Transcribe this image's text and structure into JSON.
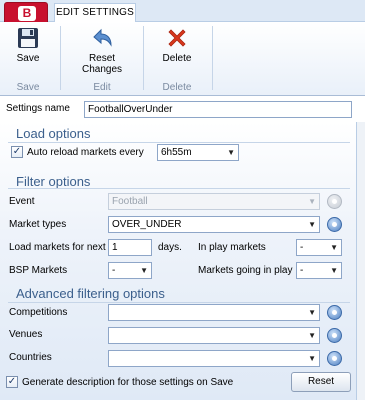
{
  "ribbon": {
    "tab_label": "EDIT SETTINGS",
    "buttons": {
      "save": "Save",
      "reset": "Reset Changes",
      "delete": "Delete"
    },
    "groups": {
      "save": "Save",
      "edit": "Edit",
      "delete": "Delete"
    }
  },
  "settings_name": {
    "label": "Settings name",
    "value": "FootballOverUnder"
  },
  "load_options": {
    "heading": "Load options",
    "auto_reload": {
      "label": "Auto reload markets every",
      "checked": true,
      "value": "6h55m"
    }
  },
  "filter_options": {
    "heading": "Filter options",
    "event": {
      "label": "Event",
      "value": "Football"
    },
    "market_types": {
      "label": "Market types",
      "value": "OVER_UNDER"
    },
    "load_markets_next": {
      "label": "Load markets for next",
      "value": "1",
      "unit": "days."
    },
    "in_play_markets": {
      "label": "In play markets",
      "value": "-"
    },
    "bsp_markets": {
      "label": "BSP Markets",
      "value": "-"
    },
    "markets_going_in_play": {
      "label": "Markets going in play",
      "value": "-"
    }
  },
  "advanced_filtering": {
    "heading": "Advanced filtering options",
    "competitions": {
      "label": "Competitions",
      "value": ""
    },
    "venues": {
      "label": "Venues",
      "value": ""
    },
    "countries": {
      "label": "Countries",
      "value": ""
    }
  },
  "footer": {
    "generate_description": {
      "label": "Generate description for those settings on Save",
      "checked": true
    },
    "reset_button": "Reset"
  },
  "colors": {
    "app_button": "#c8102e",
    "section_heading": "#3b5f8c",
    "delete_icon": "#d9381e",
    "settings_icon": "#4d7fc0"
  },
  "icons": {
    "app_logo": "b-logo-icon",
    "save": "floppy-disk-icon",
    "reset": "undo-arrow-icon",
    "delete": "red-x-icon",
    "settings": "gear-icon",
    "dropdown": "chevron-down-icon",
    "checkbox": "check-icon"
  }
}
